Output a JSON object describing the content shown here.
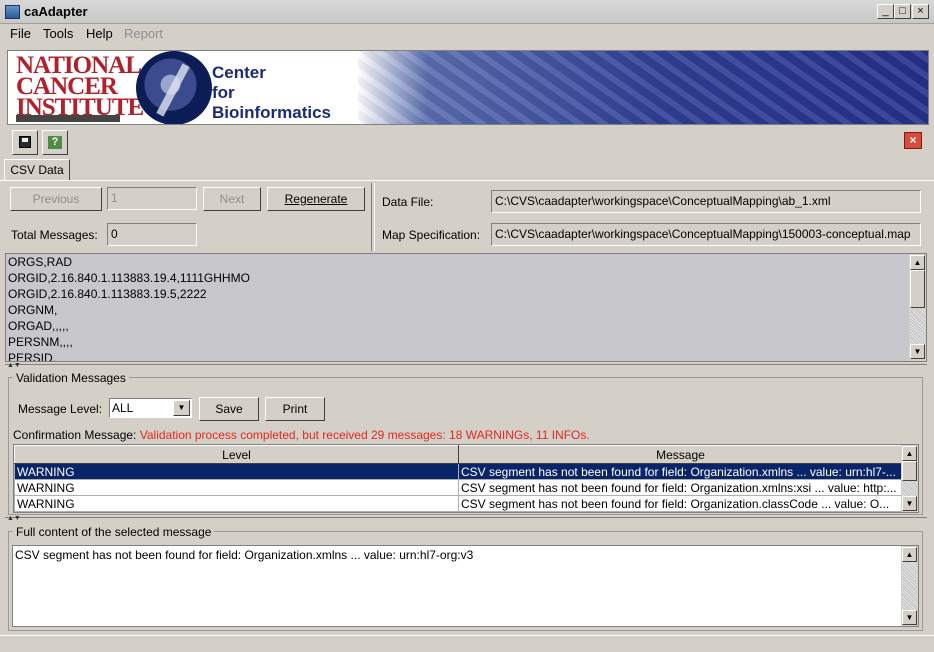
{
  "window": {
    "title": "caAdapter",
    "controls": [
      "_",
      "□",
      "×"
    ]
  },
  "menu": [
    {
      "label": "File",
      "enabled": true
    },
    {
      "label": "Tools",
      "enabled": true
    },
    {
      "label": "Help",
      "enabled": true
    },
    {
      "label": "Report",
      "enabled": false
    }
  ],
  "banner": {
    "nci_lines": [
      "NATIONAL",
      "CANCER",
      "INSTITUTE"
    ],
    "center_lines": [
      "Center",
      "for",
      "Bioinformatics"
    ]
  },
  "toolbar": {
    "save_icon": "save-icon",
    "help_icon": "help-icon",
    "close_icon": "close-icon"
  },
  "tab": {
    "label": "CSV Data"
  },
  "navigation": {
    "previous_label": "Previous",
    "page_value": "1",
    "next_label": "Next",
    "regenerate_label": "Regenerate",
    "total_messages_label": "Total Messages:",
    "total_messages_value": "0"
  },
  "files": {
    "data_file_label": "Data File:",
    "data_file_value": "C:\\CVS\\caadapter\\workingspace\\ConceptualMapping\\ab_1.xml",
    "map_spec_label": "Map Specification:",
    "map_spec_value": "C:\\CVS\\caadapter\\workingspace\\ConceptualMapping\\150003-conceptual.map"
  },
  "csv_lines": [
    "ORGS,RAD",
    "ORGID,2.16.840.1.113883.19.4,1111GHHMO",
    "ORGID,2.16.840.1.113883.19.5,2222",
    "ORGNM,",
    "ORGAD,,,,,",
    "PERSNM,,,,",
    "PERSID,"
  ],
  "validation": {
    "title": "Validation Messages",
    "message_level_label": "Message Level:",
    "message_level_value": "ALL",
    "save_label": "Save",
    "print_label": "Print",
    "confirmation_label": "Confirmation Message:",
    "confirmation_text": "Validation process completed, but received 29 messages: 18 WARNINGs, 11 INFOs.",
    "columns": [
      "Level",
      "Message"
    ],
    "rows": [
      {
        "level": "WARNING",
        "message": "CSV segment has not been found for field: Organization.xmlns ... value: urn:hl7-..."
      },
      {
        "level": "WARNING",
        "message": "CSV segment has not been found for field: Organization.xmlns:xsi ... value: http:..."
      },
      {
        "level": "WARNING",
        "message": "CSV segment has not been found for field: Organization.classCode ... value: O..."
      }
    ]
  },
  "full_content": {
    "title": "Full content of the selected message",
    "text": "CSV segment has not been found for field: Organization.xmlns ... value: urn:hl7-org:v3"
  }
}
